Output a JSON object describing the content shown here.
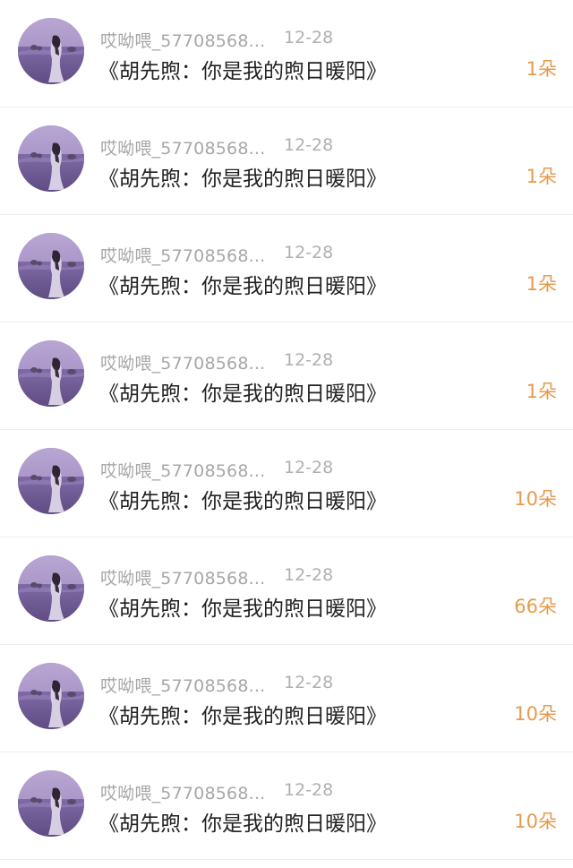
{
  "rows": [
    {
      "username": "哎呦喂_57708568...",
      "date": "12-28",
      "title": "《胡先煦：你是我的煦日暖阳》",
      "amount": "1朵"
    },
    {
      "username": "哎呦喂_57708568...",
      "date": "12-28",
      "title": "《胡先煦：你是我的煦日暖阳》",
      "amount": "1朵"
    },
    {
      "username": "哎呦喂_57708568...",
      "date": "12-28",
      "title": "《胡先煦：你是我的煦日暖阳》",
      "amount": "1朵"
    },
    {
      "username": "哎呦喂_57708568...",
      "date": "12-28",
      "title": "《胡先煦：你是我的煦日暖阳》",
      "amount": "1朵"
    },
    {
      "username": "哎呦喂_57708568...",
      "date": "12-28",
      "title": "《胡先煦：你是我的煦日暖阳》",
      "amount": "10朵"
    },
    {
      "username": "哎呦喂_57708568...",
      "date": "12-28",
      "title": "《胡先煦：你是我的煦日暖阳》",
      "amount": "66朵"
    },
    {
      "username": "哎呦喂_57708568...",
      "date": "12-28",
      "title": "《胡先煦：你是我的煦日暖阳》",
      "amount": "10朵"
    },
    {
      "username": "哎呦喂_57708568...",
      "date": "12-28",
      "title": "《胡先煦：你是我的煦日暖阳》",
      "amount": "10朵"
    }
  ],
  "colors": {
    "username": "#a7a7a7",
    "date": "#b0b0b0",
    "title": "#222222",
    "amount": "#e89a4c",
    "divider": "#eeeeee"
  },
  "icons": {
    "avatar": "avatar-lavender-field-photo"
  }
}
